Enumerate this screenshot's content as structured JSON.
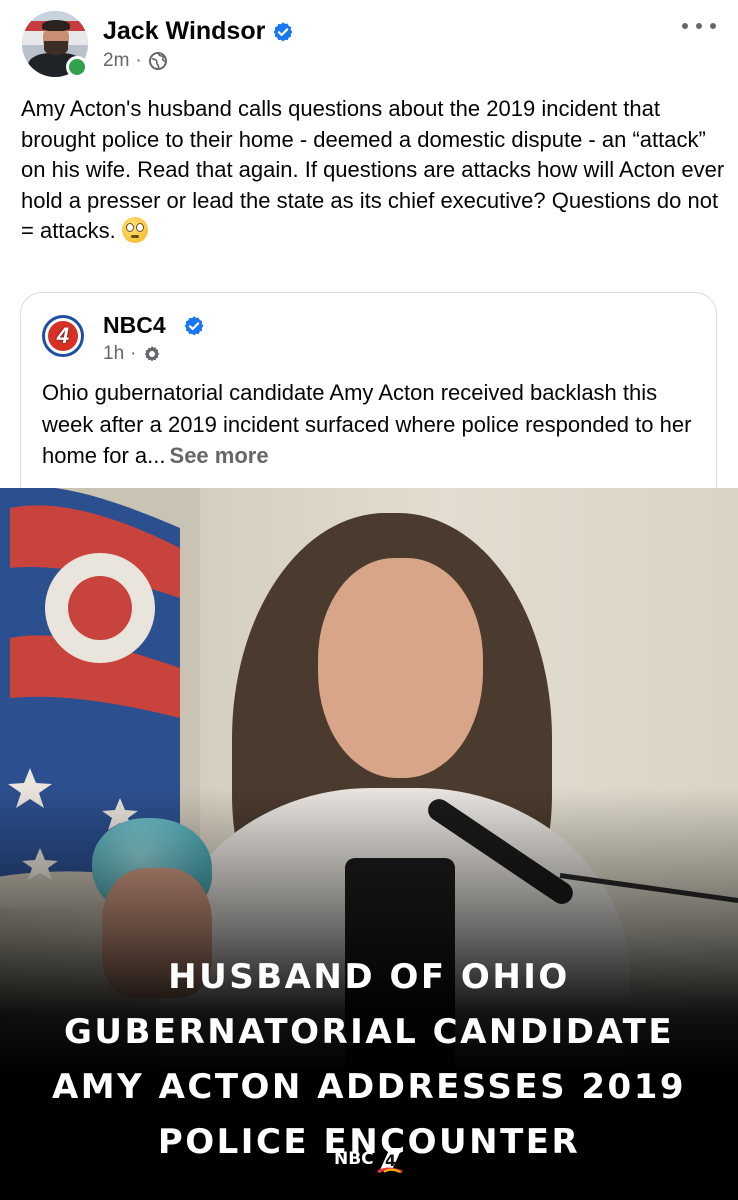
{
  "post": {
    "author": "Jack Windsor",
    "time": "2m",
    "audience_icon": "globe-icon",
    "text": "Amy Acton's husband calls questions about the 2019 incident that brought police to their home - deemed a domestic dispute - an “attack” on his wife. Read that again. If questions are attacks how will Acton ever hold a presser or lead the state as its chief executive? Questions do not = attacks.",
    "emoji": "face-with-rolling-eyes"
  },
  "shared": {
    "page_name": "NBC4",
    "logo_text": "4",
    "time": "1h",
    "audience_icon": "gear-icon",
    "text": "Ohio gubernatorial candidate Amy Acton received backlash this week after a 2019 incident surfaced where police responded to her home for a...",
    "see_more": "See more"
  },
  "media": {
    "headline_lines": [
      "HUSBAND OF OHIO",
      "GUBERNATORIAL CANDIDATE",
      "AMY ACTON ADDRESSES 2019",
      "POLICE ENCOUNTER"
    ],
    "watermark": "NBC",
    "watermark_badge": "4"
  },
  "colors": {
    "verified": "#1877f2",
    "online": "#31a24c",
    "meta_gray": "#65676b",
    "nbc_red": "#d93025"
  }
}
